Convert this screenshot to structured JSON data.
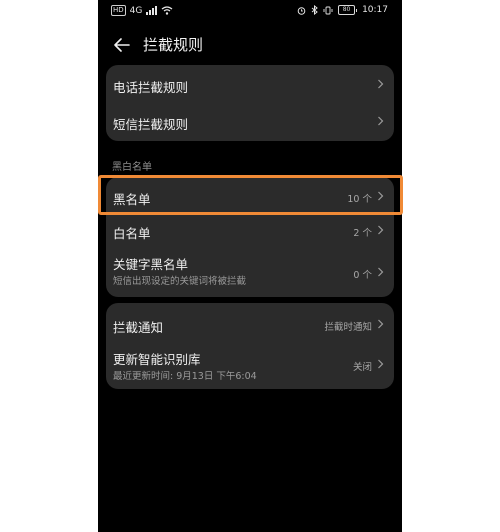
{
  "status_bar": {
    "left_badge": "HD",
    "network": "4G",
    "battery": "80",
    "time": "10:17"
  },
  "header": {
    "title": "拦截规则"
  },
  "card1": {
    "items": [
      {
        "label": "电话拦截规则"
      },
      {
        "label": "短信拦截规则"
      }
    ]
  },
  "section": {
    "label": "黑白名单"
  },
  "card2": {
    "items": [
      {
        "label": "黑名单",
        "value": "10 个"
      },
      {
        "label": "白名单",
        "value": "2 个"
      },
      {
        "label": "关键字黑名单",
        "sub": "短信出现设定的关键词将被拦截",
        "value": "0 个"
      }
    ]
  },
  "card3": {
    "items": [
      {
        "label": "拦截通知",
        "value": "拦截时通知"
      },
      {
        "label": "更新智能识别库",
        "sub": "最近更新时间: 9月13日 下午6:04",
        "value": "关闭"
      }
    ]
  },
  "colors": {
    "highlight": "#f08a36",
    "card": "#2b2b2b",
    "background": "#000000"
  }
}
